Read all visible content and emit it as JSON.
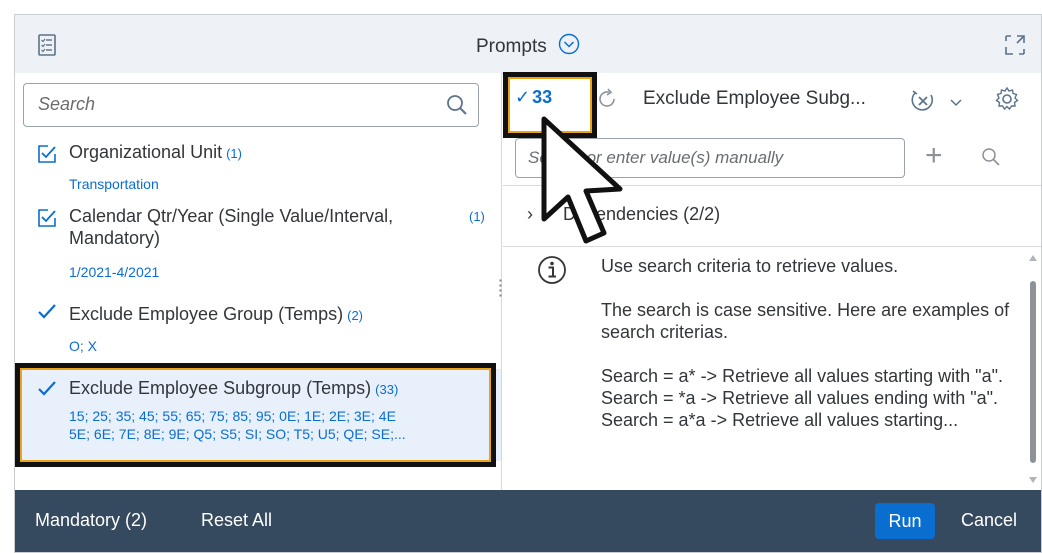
{
  "header": {
    "title": "Prompts"
  },
  "left": {
    "search_placeholder": "Search",
    "items": [
      {
        "label": "Organizational Unit",
        "count": "(1)",
        "value": "Transportation"
      },
      {
        "label_line1": "Calendar Qtr/Year (Single Value/Interval,",
        "label_line2": "Mandatory)",
        "count": "(1)",
        "value": "1/2021-4/2021"
      },
      {
        "label": "Exclude Employee Group (Temps)",
        "count": "(2)",
        "value": "O; X"
      },
      {
        "label": "Exclude Employee Subgroup (Temps)",
        "count": "(33)",
        "value_line1": "15; 25; 35; 45; 55; 65; 75; 85; 95; 0E; 1E; 2E; 3E; 4E",
        "value_line2": "5E; 6E; 7E; 8E; 9E; Q5; S5; SI; SO; T5; U5; QE; SE;..."
      }
    ]
  },
  "right": {
    "selected_count": "33",
    "title": "Exclude Employee Subg...",
    "input_placeholder": "Search or enter value(s) manually",
    "dependencies": "Dependencies (2/2)",
    "info": {
      "p1": "Use search criteria to retrieve values.",
      "p2": "The search is case sensitive. Here are examples of search criterias.",
      "l1": "Search = a* -> Retrieve all values starting with \"a\".",
      "l2": "Search = *a -> Retrieve all values ending with \"a\".",
      "l3": "Search = a*a -> Retrieve all values starting..."
    }
  },
  "footer": {
    "mandatory": "Mandatory (2)",
    "reset": "Reset All",
    "run": "Run",
    "cancel": "Cancel"
  },
  "colors": {
    "accent": "#0a6ed1",
    "footer": "#354a5f",
    "highlight": "#e8a317"
  }
}
